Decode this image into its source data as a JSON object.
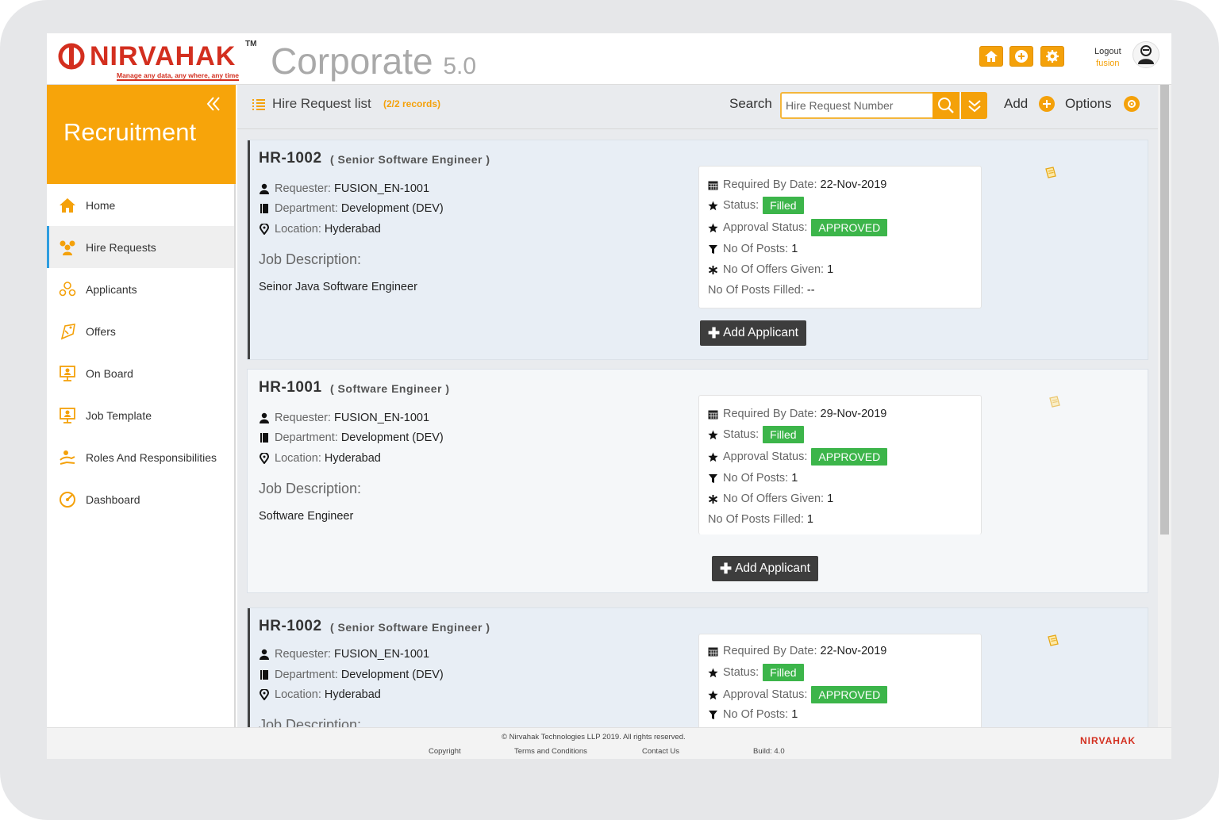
{
  "header": {
    "brand": "NIRVAHAK",
    "trademark": "TM",
    "tagline": "Manage any data, any where, any time",
    "product": "Corporate",
    "version": "5.0",
    "logout_label": "Logout",
    "username": "fusion"
  },
  "sidebar": {
    "title": "Recruitment",
    "items": [
      {
        "label": "Home",
        "icon": "home-icon"
      },
      {
        "label": "Hire Requests",
        "icon": "users-icon",
        "active": true
      },
      {
        "label": "Applicants",
        "icon": "applicants-icon"
      },
      {
        "label": "Offers",
        "icon": "offers-icon"
      },
      {
        "label": "On Board",
        "icon": "onboard-icon"
      },
      {
        "label": "Job Template",
        "icon": "job-template-icon"
      },
      {
        "label": "Roles And Responsibilities",
        "icon": "roles-icon"
      },
      {
        "label": "Dashboard",
        "icon": "dashboard-icon"
      }
    ]
  },
  "toolbar": {
    "title": "Hire Request list",
    "count": "(2/2 records)",
    "search_label": "Search",
    "search_placeholder": "Hire Request Number",
    "add_label": "Add",
    "options_label": "Options"
  },
  "labels": {
    "requester": "Requester:",
    "department": "Department:",
    "location": "Location:",
    "job_description": "Job Description:",
    "required_by": "Required By Date:",
    "status": "Status:",
    "approval_status": "Approval Status:",
    "no_of_posts": "No Of Posts:",
    "offers_given": "No Of Offers Given:",
    "posts_filled": "No Of Posts Filled:",
    "add_applicant": "Add Applicant"
  },
  "cards": [
    {
      "id": "HR-1002",
      "role": "( Senior Software Engineer )",
      "requester": "FUSION_EN-1001",
      "department": "Development (DEV)",
      "location": "Hyderabad",
      "job_description": "Seinor Java Software Engineer",
      "required_by": "22-Nov-2019",
      "status": "Filled",
      "approval_status": "APPROVED",
      "no_of_posts": "1",
      "offers_given": "1",
      "posts_filled": "--"
    },
    {
      "id": "HR-1001",
      "role": "( Software Engineer )",
      "requester": "FUSION_EN-1001",
      "department": "Development (DEV)",
      "location": "Hyderabad",
      "job_description": "Software Engineer",
      "required_by": "29-Nov-2019",
      "status": "Filled",
      "approval_status": "APPROVED",
      "no_of_posts": "1",
      "offers_given": "1",
      "posts_filled": "1"
    },
    {
      "id": "HR-1002",
      "role": "( Senior Software Engineer )",
      "requester": "FUSION_EN-1001",
      "department": "Development (DEV)",
      "location": "Hyderabad",
      "job_description_partial": "Job Description:",
      "required_by": "22-Nov-2019",
      "status": "Filled",
      "approval_status": "APPROVED",
      "no_of_posts": "1"
    }
  ],
  "footer": {
    "copyright": "© Nirvahak Technologies LLP 2019. All rights reserved.",
    "link_copyright": "Copyright",
    "link_terms": "Terms and Conditions",
    "link_contact": "Contact Us",
    "build": "Build: 4.0",
    "logo": "NIRVAHAK"
  },
  "colors": {
    "accent": "#f7a40a",
    "brand": "#d32f1f",
    "success": "#3cb54a",
    "dark_button": "#3d3d3d"
  }
}
